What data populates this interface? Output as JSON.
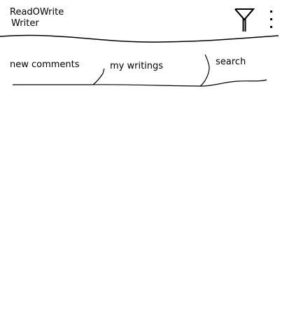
{
  "header": {
    "title_line1": "ReadOWrite",
    "title_line2": "Writer",
    "filter_icon": "filter-icon",
    "menu_icon": "more-vertical-icon"
  },
  "tabs": [
    {
      "label": "new comments"
    },
    {
      "label": "my writings"
    },
    {
      "label": "search"
    }
  ]
}
